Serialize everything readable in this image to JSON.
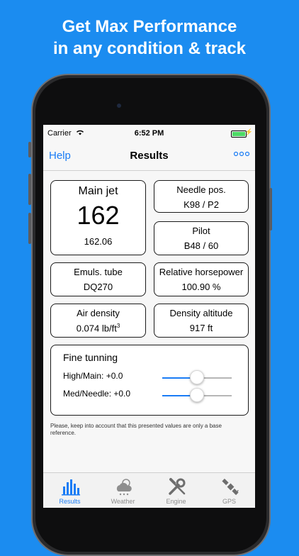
{
  "promo": {
    "line1": "Get Max Performance",
    "line2": "in any condition & track"
  },
  "status_bar": {
    "carrier": "Carrier",
    "time": "6:52 PM"
  },
  "nav": {
    "left_label": "Help",
    "title": "Results",
    "more_label": "∘∘∘"
  },
  "main_jet": {
    "label": "Main jet",
    "value": "162",
    "exact": "162.06"
  },
  "needle": {
    "label": "Needle pos.",
    "value": "K98 / P2"
  },
  "pilot": {
    "label": "Pilot",
    "value": "B48 / 60"
  },
  "emulsion": {
    "label": "Emuls. tube",
    "value": "DQ270"
  },
  "horsepower": {
    "label": "Relative horsepower",
    "value": "100.90 %"
  },
  "air_density": {
    "label": "Air density",
    "value": "0.074 lb/ft",
    "unit_exp": "3"
  },
  "density_altitude": {
    "label": "Density altitude",
    "value": "917 ft"
  },
  "fine_tuning": {
    "title": "Fine tunning",
    "rows": [
      {
        "label": "High/Main: +0.0",
        "level": 0.5
      },
      {
        "label": "Med/Needle: +0.0",
        "level": 0.5
      }
    ]
  },
  "note": "Please, keep into account that this presented values are only a base reference.",
  "tabs": [
    {
      "label": "Results",
      "icon": "bar-chart-icon",
      "active": true
    },
    {
      "label": "Weather",
      "icon": "weather-cloud-icon",
      "active": false
    },
    {
      "label": "Engine",
      "icon": "wrench-screwdriver-icon",
      "active": false
    },
    {
      "label": "GPS",
      "icon": "satellite-icon",
      "active": false
    }
  ],
  "colors": {
    "background": "#1b8cf0",
    "accent": "#1a7cf5",
    "tab_inactive": "#8e8e8e",
    "battery": "#4cd964"
  }
}
